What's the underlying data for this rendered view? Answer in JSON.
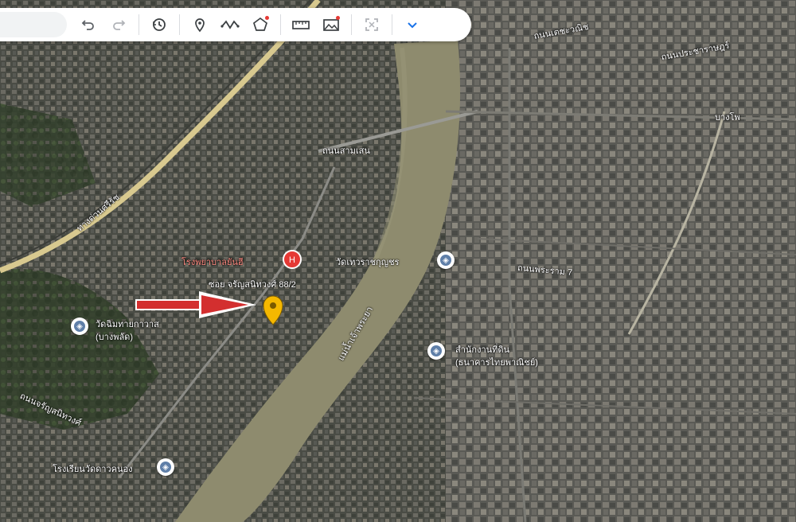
{
  "map": {
    "type": "satellite",
    "colors": {
      "river": "#8e8b6e",
      "highway": "#d8c98f",
      "arrow": "#d32f2f",
      "marker": "#f5b800",
      "hospital": "#e53935",
      "poi": "#5f7fa8"
    },
    "labels": {
      "hospital": "โรงพยาบาลยันฮี",
      "soi": "ซอย จรัญสนิทวงศ์ 88/2",
      "wat_right": "วัดเทวราชกุญชร",
      "wat_left_1": "วัดฉิมทายกาวาส",
      "wat_left_2": "(บางพลัด)",
      "land_dept_1": "สำนักงานที่ดิน",
      "land_dept_2": "(ธนาคารไทยพาณิชย์)",
      "bang_po": "บางโพ",
      "bottom_left": "โรงเรียนวัดดาวคนอง",
      "road_top": "ถนนสามเสน",
      "road_right": "ถนนประชาราษฎร์",
      "road_mid": "ถนนพระราม 7",
      "highway": "ทางด่วนศรีรัช",
      "road_left": "ถนนจรัญสนิทวงศ์",
      "river_name": "แม่น้ำเจ้าพระยา",
      "road_top_right": "ถนนเตชะวณิช"
    }
  },
  "toolbar": {
    "icons": [
      "undo-icon",
      "redo-icon",
      "history-icon",
      "pin-icon",
      "path-icon",
      "polygon-icon",
      "ruler-icon",
      "image-icon",
      "fullscreen-icon",
      "chevron-down-icon"
    ]
  }
}
